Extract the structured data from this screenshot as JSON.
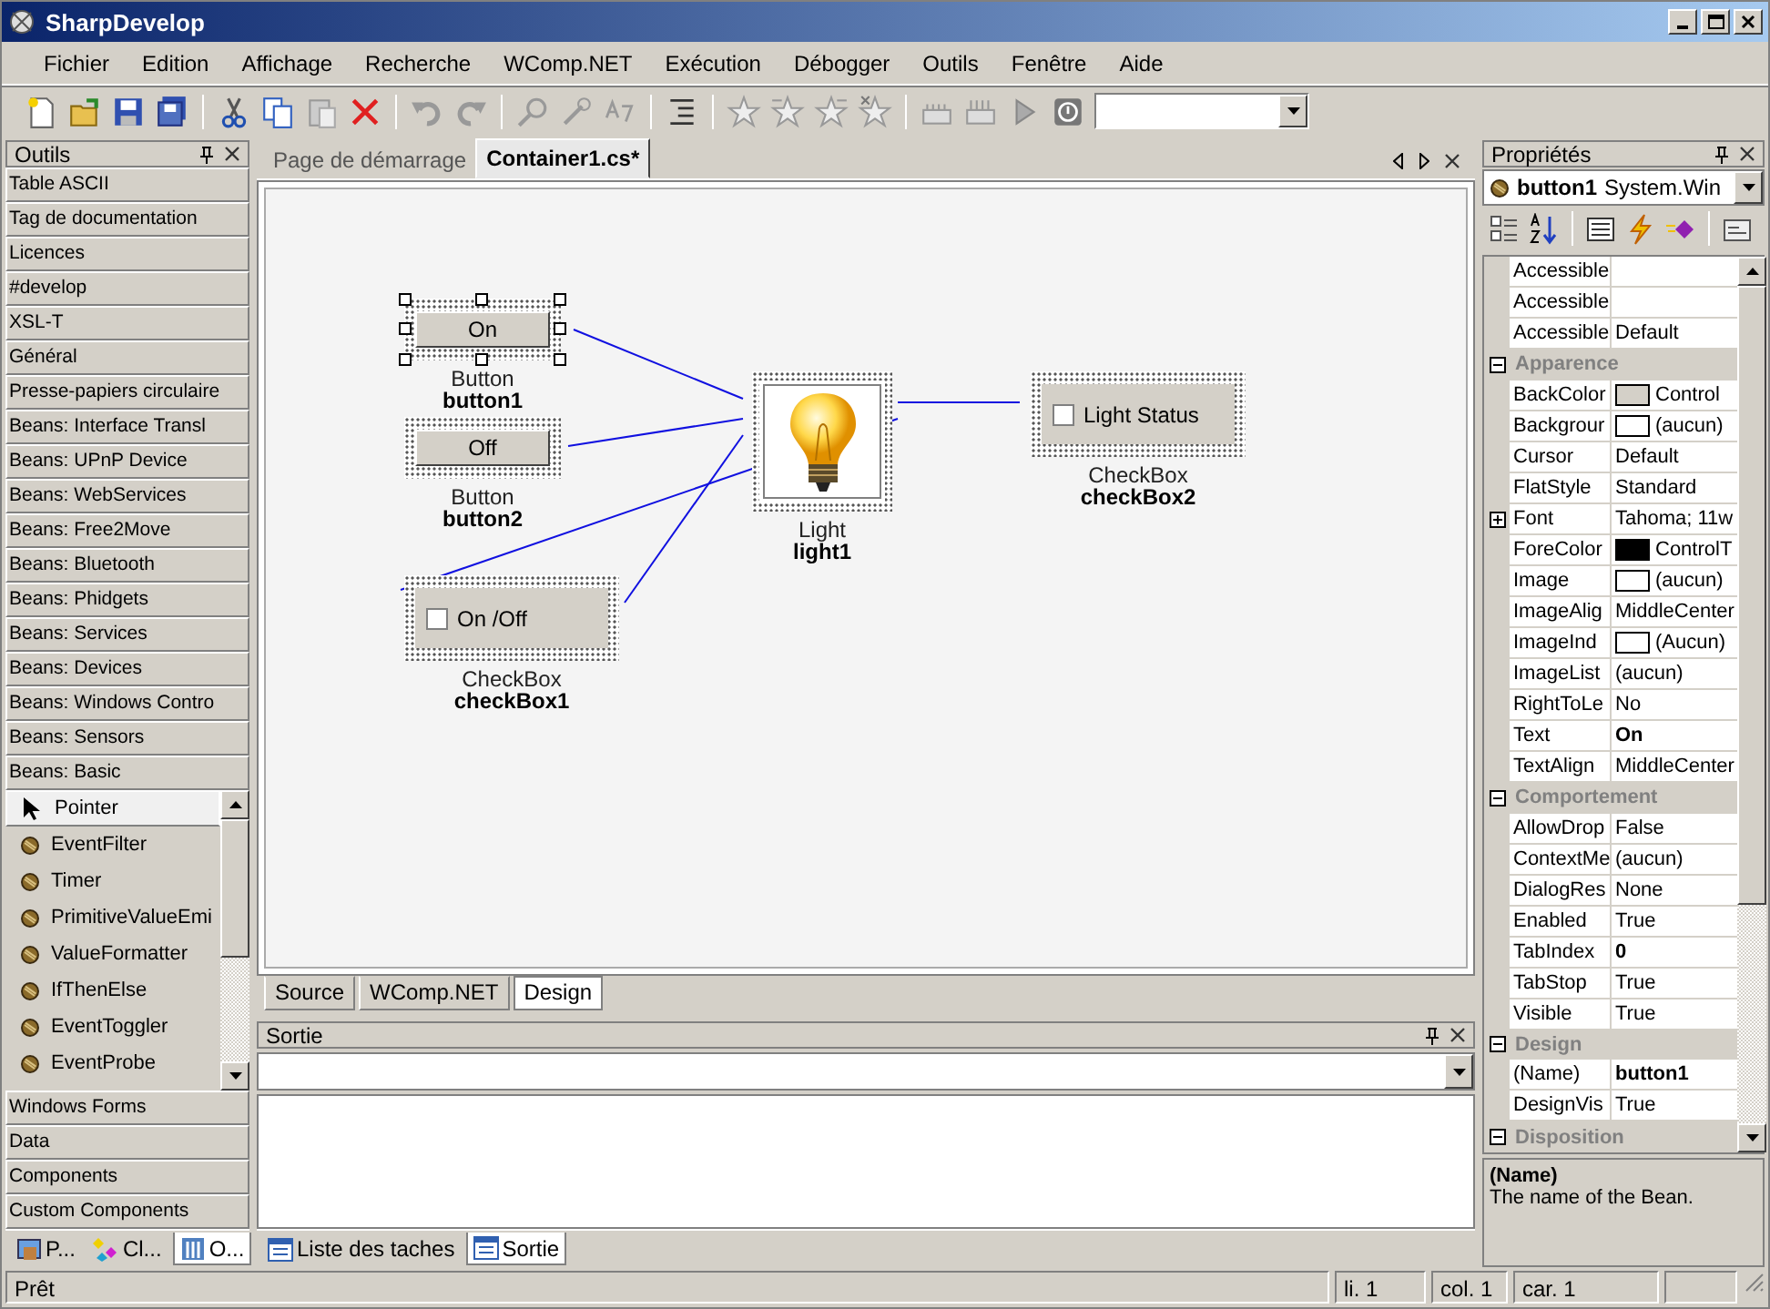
{
  "window": {
    "title": "SharpDevelop"
  },
  "menu": [
    "Fichier",
    "Edition",
    "Affichage",
    "Recherche",
    "WComp.NET",
    "Exécution",
    "Débogger",
    "Outils",
    "Fenêtre",
    "Aide"
  ],
  "tools_panel": {
    "title": "Outils",
    "categories_before": [
      "Table ASCII",
      "Tag de documentation",
      "Licences",
      "#develop",
      "XSL-T",
      "Général",
      "Presse-papiers circulaire",
      "Beans: Interface Transl",
      "Beans: UPnP Device",
      "Beans: WebServices",
      "Beans: Free2Move",
      "Beans: Bluetooth",
      "Beans: Phidgets",
      "Beans: Services",
      "Beans: Devices",
      "Beans: Windows Contro",
      "Beans: Sensors"
    ],
    "open_category": {
      "label": "Beans: Basic",
      "items": [
        {
          "kind": "pointer",
          "label": "Pointer",
          "selected": true
        },
        {
          "kind": "bean",
          "label": "EventFilter",
          "selected": false
        },
        {
          "kind": "bean",
          "label": "Timer",
          "selected": false
        },
        {
          "kind": "bean",
          "label": "PrimitiveValueEmi",
          "selected": false
        },
        {
          "kind": "bean",
          "label": "ValueFormatter",
          "selected": false
        },
        {
          "kind": "bean",
          "label": "IfThenElse",
          "selected": false
        },
        {
          "kind": "bean",
          "label": "EventToggler",
          "selected": false
        },
        {
          "kind": "bean",
          "label": "EventProbe",
          "selected": false
        }
      ]
    },
    "categories_after": [
      "Windows Forms",
      "Data",
      "Components",
      "Custom Components"
    ],
    "tabs": [
      {
        "label": "P...",
        "selected": false
      },
      {
        "label": "Cl...",
        "selected": false
      },
      {
        "label": "O...",
        "selected": true
      }
    ]
  },
  "document_tabs": [
    {
      "label": "Page de démarrage",
      "selected": false
    },
    {
      "label": "Container1.cs*",
      "selected": true
    }
  ],
  "diagram": {
    "nodes": [
      {
        "kind": "button",
        "text": "On",
        "type": "Button",
        "name": "button1",
        "selected": true
      },
      {
        "kind": "button",
        "text": "Off",
        "type": "Button",
        "name": "button2",
        "selected": false
      },
      {
        "kind": "checkbox",
        "text": "On /Off",
        "type": "CheckBox",
        "name": "checkBox1",
        "checked": false,
        "selected": false
      },
      {
        "kind": "light",
        "type": "Light",
        "name": "light1",
        "selected": false
      },
      {
        "kind": "checkbox",
        "text": "Light Status",
        "type": "CheckBox",
        "name": "checkBox2",
        "checked": false,
        "selected": false
      }
    ]
  },
  "view_tabs": [
    {
      "label": "Source",
      "selected": false
    },
    {
      "label": "WComp.NET",
      "selected": false
    },
    {
      "label": "Design",
      "selected": true
    }
  ],
  "output_panel": {
    "title": "Sortie",
    "tabs": [
      {
        "label": "Liste des taches",
        "selected": false
      },
      {
        "label": "Sortie",
        "selected": true
      }
    ]
  },
  "properties": {
    "title": "Propriétés",
    "object_name": "button1",
    "object_type": "System.Win",
    "groups": [
      {
        "rows": [
          {
            "name": "Accessible"
          },
          {
            "name": "Accessible"
          },
          {
            "name": "Accessible",
            "value": "Default"
          }
        ]
      },
      {
        "title": "Apparence",
        "expanded": true,
        "rows": [
          {
            "name": "BackColor",
            "value": "Control",
            "color": "#d4d0c8"
          },
          {
            "name": "Backgrour",
            "value": "(aucun)",
            "color": "#ffffff"
          },
          {
            "name": "Cursor",
            "value": "Default"
          },
          {
            "name": "FlatStyle",
            "value": "Standard"
          },
          {
            "name": "Font",
            "value": "Tahoma; 11w",
            "expandable": true
          },
          {
            "name": "ForeColor",
            "value": "ControlT",
            "color": "#000000"
          },
          {
            "name": "Image",
            "value": "(aucun)",
            "color": "#ffffff"
          },
          {
            "name": "ImageAlig",
            "value": "MiddleCenter"
          },
          {
            "name": "ImageInd",
            "value": "(Aucun)",
            "color": "#ffffff"
          },
          {
            "name": "ImageList",
            "value": "(aucun)"
          },
          {
            "name": "RightToLe",
            "value": "No"
          },
          {
            "name": "Text",
            "value": "On",
            "modified": true
          },
          {
            "name": "TextAlign",
            "value": "MiddleCenter"
          }
        ]
      },
      {
        "title": "Comportement",
        "expanded": true,
        "rows": [
          {
            "name": "AllowDrop",
            "value": "False"
          },
          {
            "name": "ContextMe",
            "value": "(aucun)"
          },
          {
            "name": "DialogRes",
            "value": "None"
          },
          {
            "name": "Enabled",
            "value": "True"
          },
          {
            "name": "TabIndex",
            "value": "0",
            "modified": true
          },
          {
            "name": "TabStop",
            "value": "True"
          },
          {
            "name": "Visible",
            "value": "True"
          }
        ]
      },
      {
        "title": "Design",
        "expanded": true,
        "rows": [
          {
            "name": "(Name)",
            "value": "button1",
            "modified": true
          },
          {
            "name": "DesignVis",
            "value": "True"
          }
        ]
      },
      {
        "title": "Disposition",
        "expanded": true
      }
    ],
    "description": {
      "title": "(Name)",
      "text": "The name of the Bean."
    }
  },
  "status_bar": {
    "message": "Prêt",
    "line": "li. 1",
    "column": "col. 1",
    "character": "car. 1"
  }
}
